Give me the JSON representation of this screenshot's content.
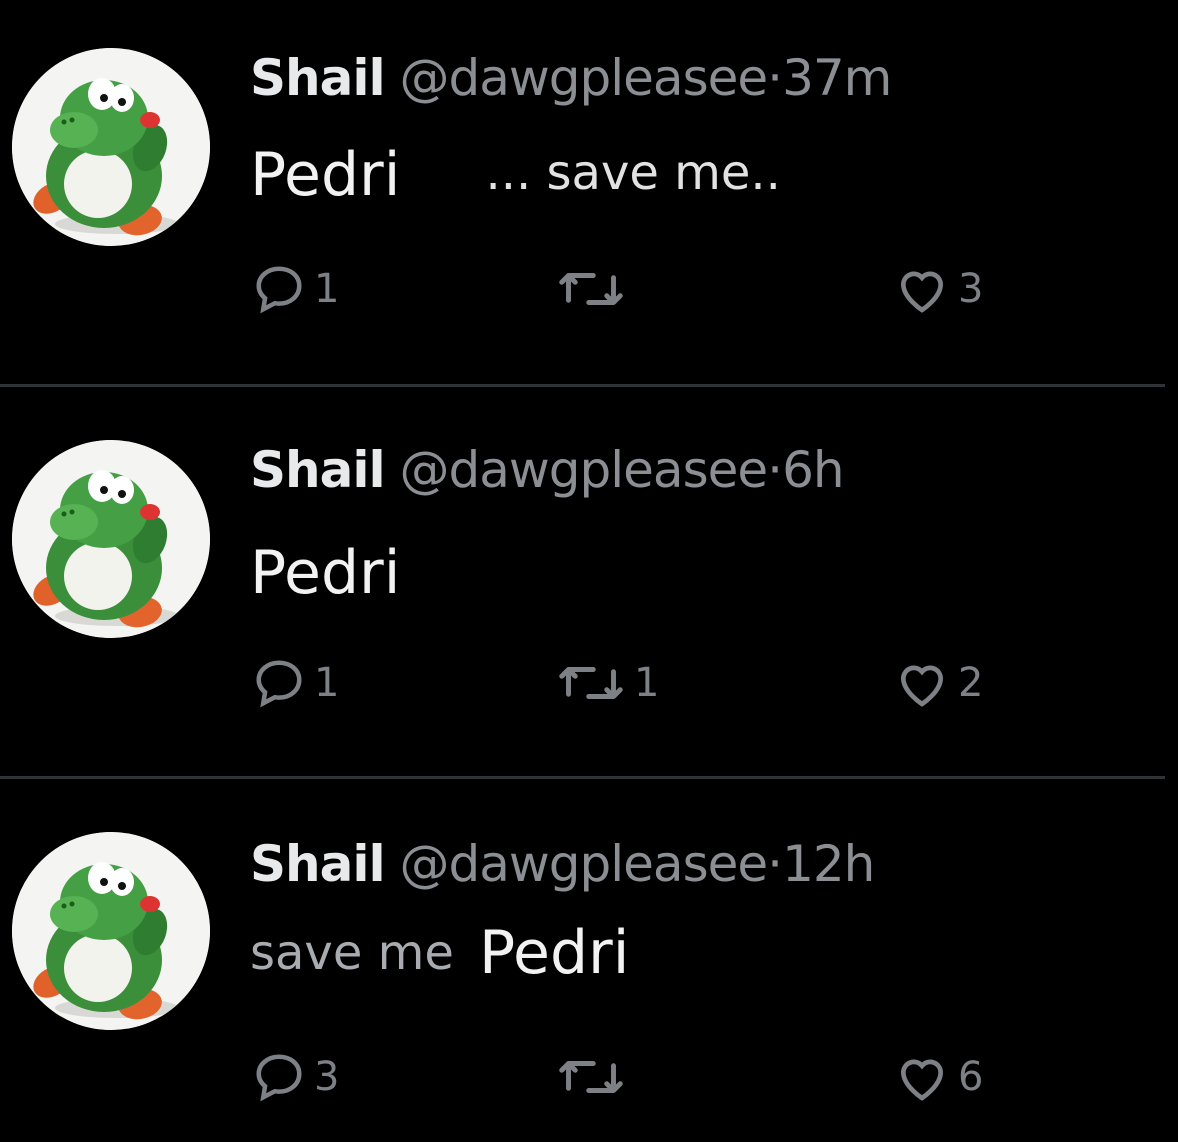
{
  "tweets": [
    {
      "name": "Shail",
      "handle": "@dawgpleasee",
      "separator": "·",
      "time": "37m",
      "text_parts": [
        "Pedri",
        "... save me.."
      ],
      "replies": "1",
      "retweets": "",
      "likes": "3"
    },
    {
      "name": "Shail",
      "handle": "@dawgpleasee",
      "separator": "·",
      "time": "6h",
      "text_parts": [
        "Pedri"
      ],
      "replies": "1",
      "retweets": "1",
      "likes": "2"
    },
    {
      "name": "Shail",
      "handle": "@dawgpleasee",
      "separator": "·",
      "time": "12h",
      "text_parts": [
        "save me",
        "Pedri"
      ],
      "replies": "3",
      "retweets": "",
      "likes": "6"
    }
  ],
  "icons": {
    "reply": "reply-icon",
    "retweet": "retweet-icon",
    "like": "heart-icon",
    "avatar": "yoshi-avatar"
  },
  "colors": {
    "background": "#000000",
    "name": "#e7e9ea",
    "muted": "#8b8f94",
    "divider": "#2f3336",
    "avatar_green": "#3f9a3f"
  }
}
